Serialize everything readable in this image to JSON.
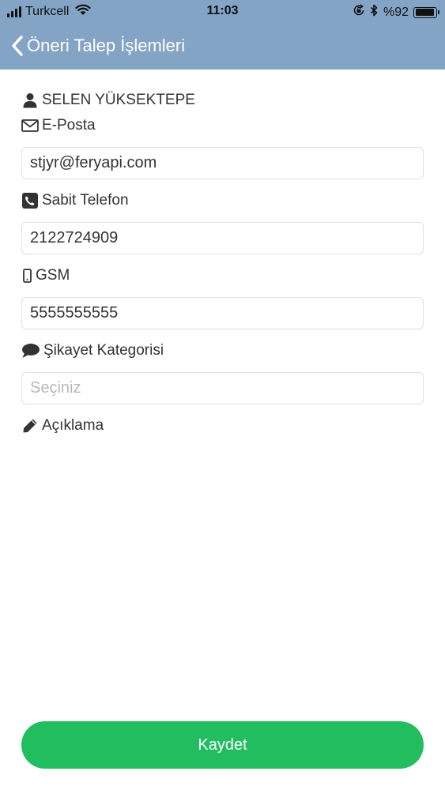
{
  "status_bar": {
    "carrier": "Turkcell",
    "time": "11:03",
    "battery": "%92",
    "battery_level": 0.92,
    "icons": [
      "signal-icon",
      "wifi-icon",
      "orientation-lock-icon",
      "bluetooth-icon",
      "battery-icon"
    ]
  },
  "navbar": {
    "back_icon": "chevron-left-icon",
    "title": "Öneri Talep İşlemleri"
  },
  "form": {
    "user_name": "SELEN YÜKSEKTEPE",
    "email": {
      "label": "E-Posta",
      "value": "stjyr@feryapi.com",
      "icon": "envelope-icon"
    },
    "landline": {
      "label": "Sabit Telefon",
      "value": "2122724909",
      "icon": "phone-square-icon"
    },
    "gsm": {
      "label": "GSM",
      "value": "5555555555",
      "icon": "mobile-phone-icon"
    },
    "category": {
      "label": "Şikayet Kategorisi",
      "placeholder": "Seçiniz",
      "icon": "comment-icon"
    },
    "description": {
      "label": "Açıklama",
      "icon": "pencil-icon"
    }
  },
  "actions": {
    "save_label": "Kaydet"
  },
  "colors": {
    "header": "#84a4c6",
    "primary_button": "#22bd5f",
    "text": "#333333",
    "placeholder": "#b8b8b8"
  }
}
